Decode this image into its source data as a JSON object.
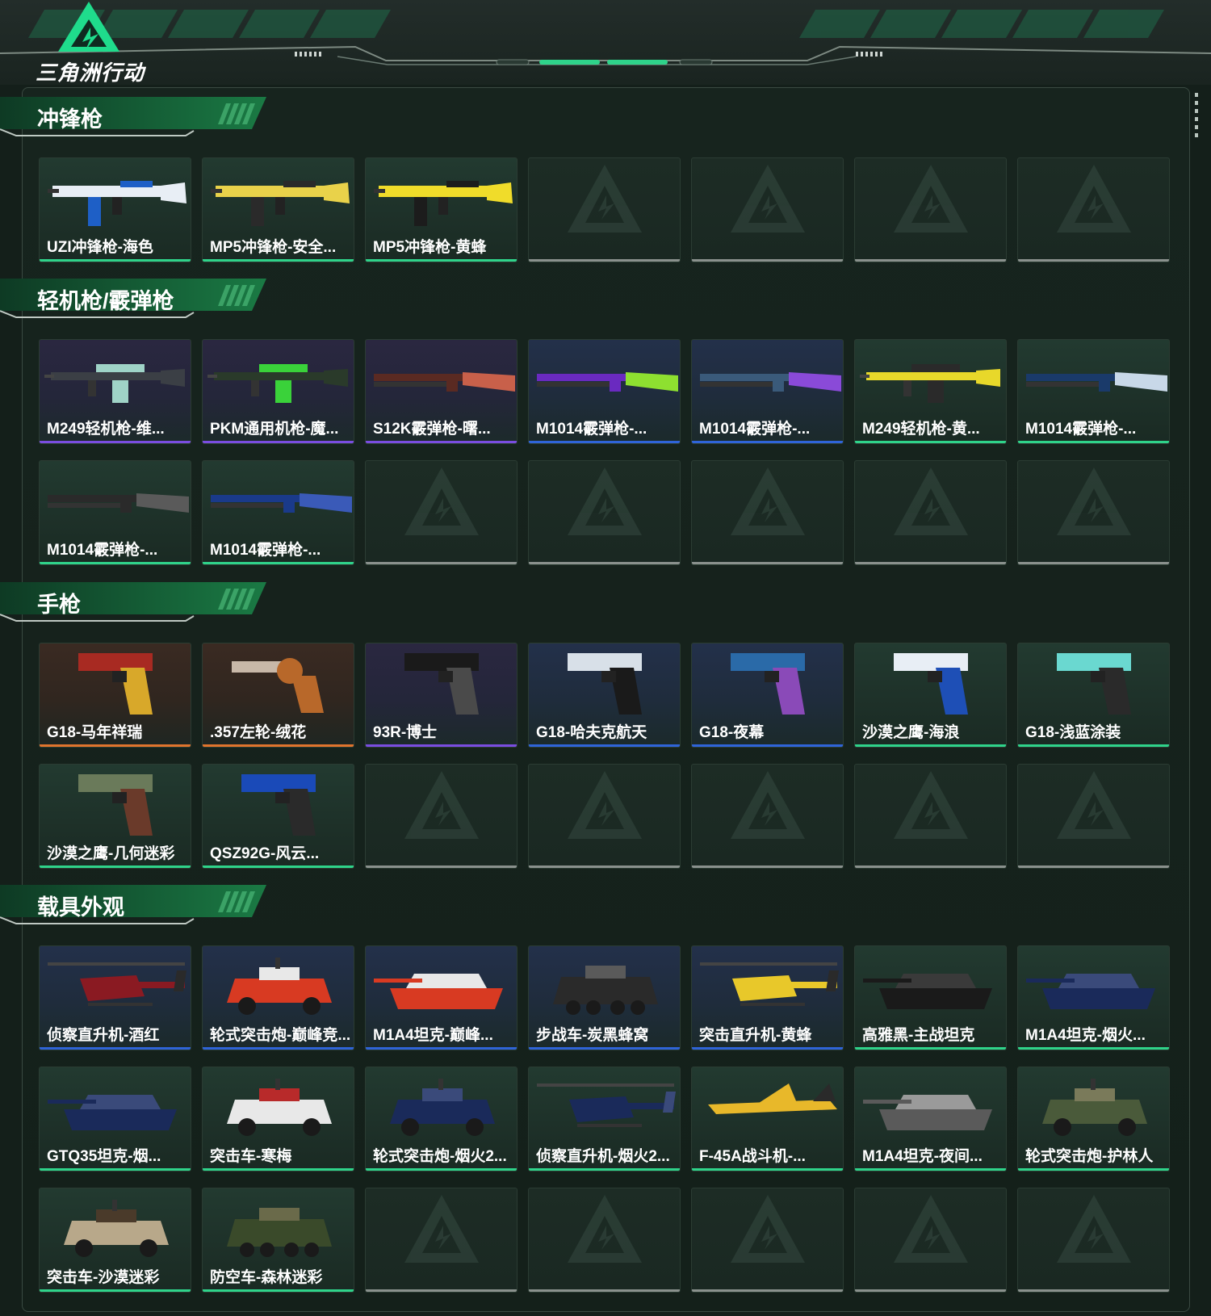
{
  "app": {
    "logo_text": "三角洲行动"
  },
  "colors": {
    "purple": "#7a4de0",
    "blue": "#2f64d8",
    "green": "#2fd38a",
    "orange": "#e0742d",
    "empty": "#8a918d",
    "accent": "#1fdc8c"
  },
  "sections": [
    {
      "title": "冲锋枪",
      "items": [
        {
          "name": "UZI冲锋枪-海色",
          "rarity": "green",
          "icon": "smg-icon",
          "art_colors": [
            "#e8eef5",
            "#1e5fc6"
          ]
        },
        {
          "name": "MP5冲锋枪-安全...",
          "rarity": "green",
          "icon": "smg-icon",
          "art_colors": [
            "#e9d24a",
            "#2a2a2a"
          ]
        },
        {
          "name": "MP5冲锋枪-黄蜂",
          "rarity": "green",
          "icon": "smg-icon",
          "art_colors": [
            "#f0dc2a",
            "#1c1c1c"
          ]
        }
      ],
      "empty_slots": 4
    },
    {
      "title": "轻机枪/霰弹枪",
      "items": [
        {
          "name": "M249轻机枪-维...",
          "rarity": "purple",
          "icon": "lmg-icon",
          "art_colors": [
            "#3b3f45",
            "#9fd3c7"
          ]
        },
        {
          "name": "PKM通用机枪-魔...",
          "rarity": "purple",
          "icon": "lmg-icon",
          "art_colors": [
            "#2a3a2a",
            "#3ad23a"
          ]
        },
        {
          "name": "S12K霰弹枪-曙...",
          "rarity": "purple",
          "icon": "shotgun-icon",
          "art_colors": [
            "#5a2a22",
            "#c8604a"
          ]
        },
        {
          "name": "M1014霰弹枪-...",
          "rarity": "blue",
          "icon": "shotgun-icon",
          "art_colors": [
            "#6a2ac0",
            "#8ee030"
          ]
        },
        {
          "name": "M1014霰弹枪-...",
          "rarity": "blue",
          "icon": "shotgun-icon",
          "art_colors": [
            "#3a5a7a",
            "#8a4ad8"
          ]
        },
        {
          "name": "M249轻机枪-黄...",
          "rarity": "green",
          "icon": "lmg-icon",
          "art_colors": [
            "#e8d82a",
            "#2a2a2a"
          ]
        },
        {
          "name": "M1014霰弹枪-...",
          "rarity": "green",
          "icon": "shotgun-icon",
          "art_colors": [
            "#1a3a6a",
            "#c8d8e8"
          ]
        },
        {
          "name": "M1014霰弹枪-...",
          "rarity": "green",
          "icon": "shotgun-icon",
          "art_colors": [
            "#2a2a2a",
            "#5a5a5a"
          ]
        },
        {
          "name": "M1014霰弹枪-...",
          "rarity": "green",
          "icon": "shotgun-icon",
          "art_colors": [
            "#1a3a8a",
            "#3a5ab8"
          ]
        }
      ],
      "empty_slots": 5
    },
    {
      "title": "手枪",
      "items": [
        {
          "name": "G18-马年祥瑞",
          "rarity": "orange",
          "icon": "pistol-icon",
          "art_colors": [
            "#a82a22",
            "#d8a82a"
          ]
        },
        {
          "name": ".357左轮-绒花",
          "rarity": "orange",
          "icon": "revolver-icon",
          "art_colors": [
            "#c8b8a8",
            "#b8682a"
          ]
        },
        {
          "name": "93R-博士",
          "rarity": "purple",
          "icon": "pistol-icon",
          "art_colors": [
            "#1a1a1a",
            "#4a4a4a"
          ]
        },
        {
          "name": "G18-哈夫克航天",
          "rarity": "blue",
          "icon": "pistol-icon",
          "art_colors": [
            "#d8e0e8",
            "#1a1a1a"
          ]
        },
        {
          "name": "G18-夜幕",
          "rarity": "blue",
          "icon": "pistol-icon",
          "art_colors": [
            "#2a6aa8",
            "#8a4ab8"
          ]
        },
        {
          "name": "沙漠之鹰-海浪",
          "rarity": "green",
          "icon": "pistol-icon",
          "art_colors": [
            "#e8eef5",
            "#1e4fb6"
          ]
        },
        {
          "name": "G18-浅蓝涂装",
          "rarity": "green",
          "icon": "pistol-icon",
          "art_colors": [
            "#6ad8d0",
            "#2a2a2a"
          ]
        },
        {
          "name": "沙漠之鹰-几何迷彩",
          "rarity": "green",
          "icon": "pistol-icon",
          "art_colors": [
            "#6a7a5a",
            "#6a3a2a"
          ]
        },
        {
          "name": "QSZ92G-风云...",
          "rarity": "green",
          "icon": "pistol-icon",
          "art_colors": [
            "#1a4ab8",
            "#2a2a2a"
          ]
        }
      ],
      "empty_slots": 5
    },
    {
      "title": "载具外观",
      "items": [
        {
          "name": "侦察直升机-酒红",
          "rarity": "blue",
          "icon": "helicopter-icon",
          "art_colors": [
            "#8a1a22",
            "#2a2a2a"
          ]
        },
        {
          "name": "轮式突击炮-巅峰竞...",
          "rarity": "blue",
          "icon": "armored-car-icon",
          "art_colors": [
            "#d83a22",
            "#e8e8e8"
          ]
        },
        {
          "name": "M1A4坦克-巅峰...",
          "rarity": "blue",
          "icon": "tank-icon",
          "art_colors": [
            "#d83a22",
            "#e8e8e8"
          ]
        },
        {
          "name": "步战车-炭黑蜂窝",
          "rarity": "blue",
          "icon": "ifv-icon",
          "art_colors": [
            "#2a2a2a",
            "#5a5a5a"
          ]
        },
        {
          "name": "突击直升机-黄蜂",
          "rarity": "blue",
          "icon": "helicopter-icon",
          "art_colors": [
            "#e8c82a",
            "#2a2a2a"
          ]
        },
        {
          "name": "高雅黑-主战坦克",
          "rarity": "green",
          "icon": "tank-icon",
          "art_colors": [
            "#1a1a1a",
            "#3a3a3a"
          ]
        },
        {
          "name": "M1A4坦克-烟火...",
          "rarity": "green",
          "icon": "tank-icon",
          "art_colors": [
            "#1a2a5a",
            "#3a4a7a"
          ]
        },
        {
          "name": "GTQ35坦克-烟...",
          "rarity": "green",
          "icon": "tank-icon",
          "art_colors": [
            "#1a2a5a",
            "#3a4a7a"
          ]
        },
        {
          "name": "突击车-寒梅",
          "rarity": "green",
          "icon": "assault-vehicle-icon",
          "art_colors": [
            "#e8e8e8",
            "#b82a2a"
          ]
        },
        {
          "name": "轮式突击炮-烟火2...",
          "rarity": "green",
          "icon": "armored-car-icon",
          "art_colors": [
            "#1a2a5a",
            "#3a4a7a"
          ]
        },
        {
          "name": "侦察直升机-烟火2...",
          "rarity": "green",
          "icon": "helicopter-icon",
          "art_colors": [
            "#1a2a5a",
            "#3a4a7a"
          ]
        },
        {
          "name": "F-45A战斗机-...",
          "rarity": "green",
          "icon": "fighter-jet-icon",
          "art_colors": [
            "#e8b82a",
            "#2a2a2a"
          ]
        },
        {
          "name": "M1A4坦克-夜间...",
          "rarity": "green",
          "icon": "tank-icon",
          "art_colors": [
            "#5a5a5a",
            "#9a9a9a"
          ]
        },
        {
          "name": "轮式突击炮-护林人",
          "rarity": "green",
          "icon": "armored-car-icon",
          "art_colors": [
            "#4a5a3a",
            "#7a7a5a"
          ]
        },
        {
          "name": "突击车-沙漠迷彩",
          "rarity": "green",
          "icon": "assault-vehicle-icon",
          "art_colors": [
            "#b8a88a",
            "#4a3a2a"
          ]
        },
        {
          "name": "防空车-森林迷彩",
          "rarity": "green",
          "icon": "aa-vehicle-icon",
          "art_colors": [
            "#3a4a2a",
            "#6a6a4a"
          ]
        }
      ],
      "empty_slots": 5
    }
  ]
}
